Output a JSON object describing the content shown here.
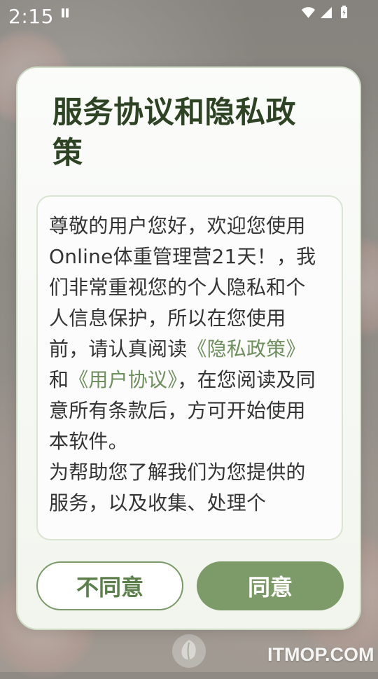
{
  "status_bar": {
    "time": "2:15"
  },
  "dialog": {
    "title": "服务协议和隐私政策",
    "body": {
      "paragraph1_before_link1": "尊敬的用户您好，欢迎您使用Online体重管理营21天！，我们非常重视您的个人隐私和个人信息保护，所以在您使用前，请认真阅读",
      "link1": "《隐私政策》",
      "between_links": "和",
      "link2": "《用户协议》",
      "paragraph1_after_link2": "，在您阅读及同意所有条款后，方可开始使用本软件。",
      "paragraph2": "为帮助您了解我们为您提供的服务，以及收集、处理个"
    },
    "buttons": {
      "disagree": "不同意",
      "agree": "同意"
    }
  },
  "watermark": {
    "text": "ITMOP.COM"
  },
  "icons": {
    "notification": "notification-icon",
    "wifi": "wifi-icon",
    "signal": "signal-icon",
    "battery": "battery-icon",
    "logo": "leaf-logo-icon"
  },
  "colors": {
    "accent": "#7d9a69",
    "title": "#2e4224",
    "link": "#6f8f5e"
  }
}
